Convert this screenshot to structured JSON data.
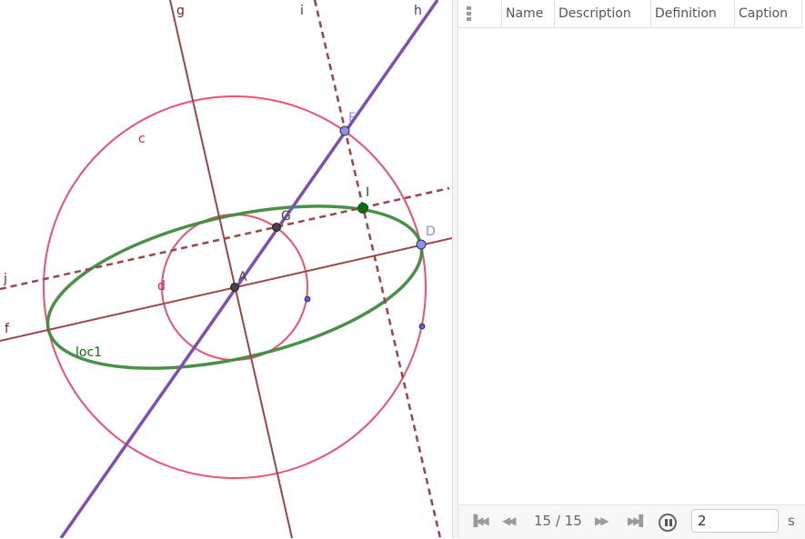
{
  "graphics": {
    "colors": {
      "circle": "#f0506e",
      "line_dark": "#9b4646",
      "line_h": "#7d4fb4",
      "ellipse": "#3f8a3f",
      "point_free": "#8a8ef0",
      "point_dep": "#444444",
      "point_I": "#0b6a0b",
      "point_small": "#5a5ae6"
    },
    "labels": {
      "g": "g",
      "i": "i",
      "h": "h",
      "c": "c",
      "F": "F",
      "I": "I",
      "G": "G",
      "D": "D",
      "j": "j",
      "A": "A",
      "d": "d",
      "f": "f",
      "loc1": "loc1"
    }
  },
  "algebra": {
    "columns": [
      "Name",
      "Description",
      "Definition",
      "Caption"
    ],
    "menu_icon": "more-vertical-icon"
  },
  "playback": {
    "step_text": "15 / 15",
    "speed_value": "2",
    "unit": "s",
    "buttons": [
      "skip-to-start",
      "step-back",
      "step-forward",
      "skip-to-end",
      "pause"
    ]
  }
}
